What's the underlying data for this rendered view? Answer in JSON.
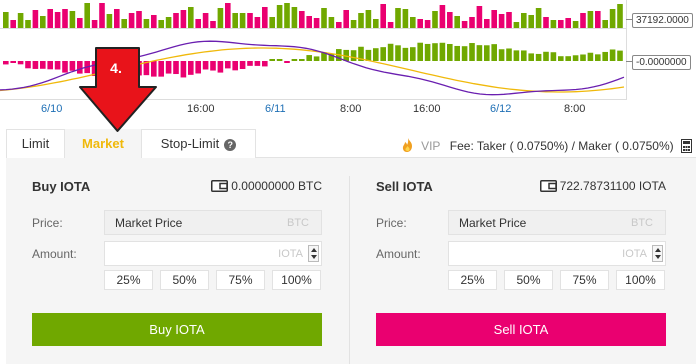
{
  "chart": {
    "price_tag": "37192.0000",
    "osc_tag": "-0.0000000",
    "time_labels": [
      "6/10",
      "16:00",
      "6/11",
      "8:00",
      "16:00",
      "6/12",
      "8:00"
    ],
    "colors": {
      "up": "#70a800",
      "down": "#ea0070",
      "line_a": "#f0b90b",
      "line_b": "#6a1fb0",
      "day_label": "#1e6fb5"
    }
  },
  "annotation": {
    "step": "4."
  },
  "tabs": [
    {
      "label": "Limit"
    },
    {
      "label": "Market"
    },
    {
      "label": "Stop-Limit"
    }
  ],
  "fee": {
    "vip": "VIP",
    "text": "Fee: Taker ( 0.0750%) / Maker ( 0.0750%)"
  },
  "buy": {
    "title": "Buy IOTA",
    "balance": "0.00000000 BTC",
    "price_label": "Price:",
    "price_value": "Market Price",
    "price_unit": "BTC",
    "amount_label": "Amount:",
    "amount_value": "",
    "amount_unit": "IOTA",
    "percents": [
      "25%",
      "50%",
      "75%",
      "100%"
    ],
    "button": "Buy IOTA"
  },
  "sell": {
    "title": "Sell IOTA",
    "balance": "722.78731100 IOTA",
    "price_label": "Price:",
    "price_value": "Market Price",
    "price_unit": "BTC",
    "amount_label": "Amount:",
    "amount_value": "",
    "amount_unit": "IOTA",
    "percents": [
      "25%",
      "50%",
      "75%",
      "100%"
    ],
    "button": "Sell IOTA"
  },
  "colors": {
    "accent": "#f0b90b",
    "buy": "#70a800",
    "sell": "#ea0070",
    "arrow": "#e8131a"
  }
}
